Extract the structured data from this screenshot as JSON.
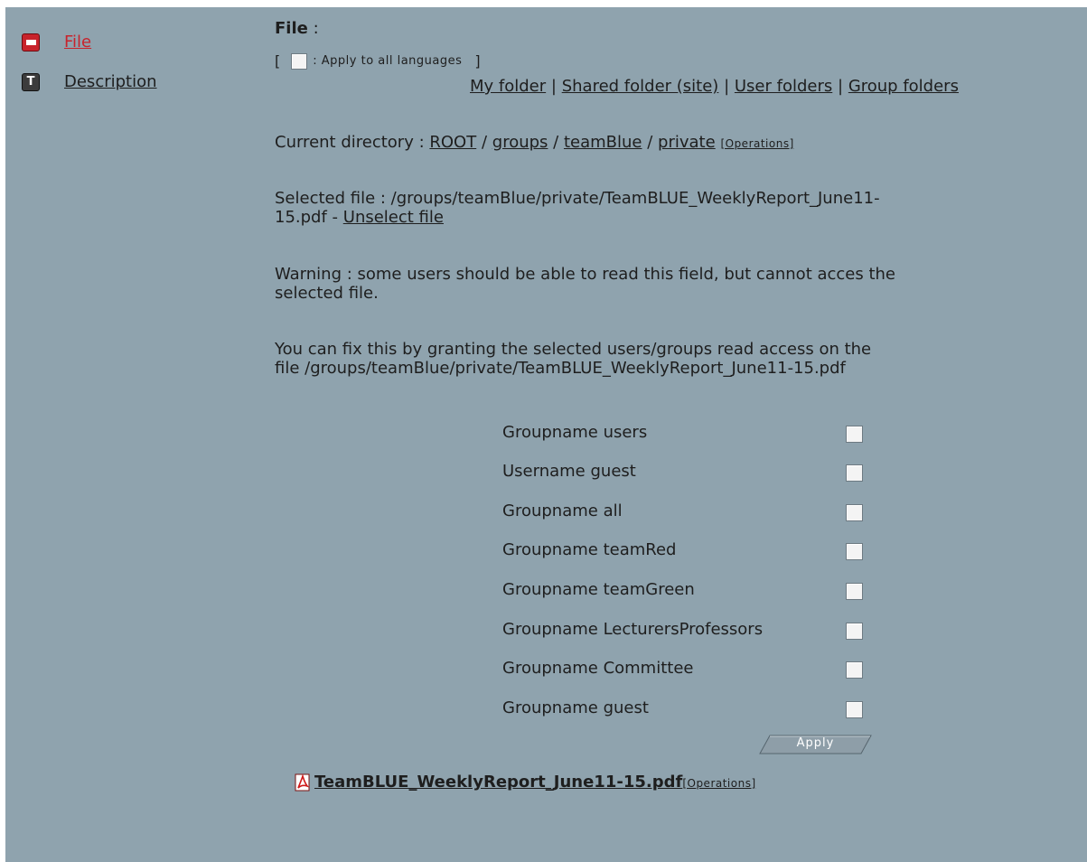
{
  "nav": {
    "file_label": "File",
    "description_label": "Description"
  },
  "field": {
    "title": "File",
    "title_colon": " :",
    "apply_bracket_open": "[",
    "apply_label": ": Apply to all languages",
    "apply_bracket_close": "]"
  },
  "folders": {
    "my_folder": "My folder",
    "shared_folder": "Shared folder (site)",
    "user_folders": "User folders",
    "group_folders": "Group folders",
    "separator": "|"
  },
  "directory": {
    "label": "Current directory :",
    "root": "ROOT",
    "groups": "groups",
    "team": "teamBlue",
    "private": "private",
    "sep": "/",
    "operations": "[Operations]"
  },
  "selected": {
    "line1": "Selected file : /groups/teamBlue/private/TeamBLUE_WeeklyReport_June11-",
    "line2_prefix": "15.pdf - ",
    "unselect": "Unselect file"
  },
  "warning": {
    "line1": "Warning : some users should be able to read this field, but cannot acces the",
    "line2": "selected file."
  },
  "fix": {
    "line1": "You can fix this by granting the selected users/groups read access on the",
    "line2": "file /groups/teamBlue/private/TeamBLUE_WeeklyReport_June11-15.pdf"
  },
  "permissions": [
    "Groupname users",
    "Username guest",
    "Groupname all",
    "Groupname teamRed",
    "Groupname teamGreen",
    "Groupname LecturersProfessors",
    "Groupname Committee",
    "Groupname guest"
  ],
  "apply_button": "Apply",
  "file_link": {
    "name": "TeamBLUE_WeeklyReport_June11-15.pdf",
    "operations": "[Operations]"
  },
  "colors": {
    "background": "#8fa3ae",
    "accent_red": "#c8232c",
    "button": "#8e9ea8"
  }
}
